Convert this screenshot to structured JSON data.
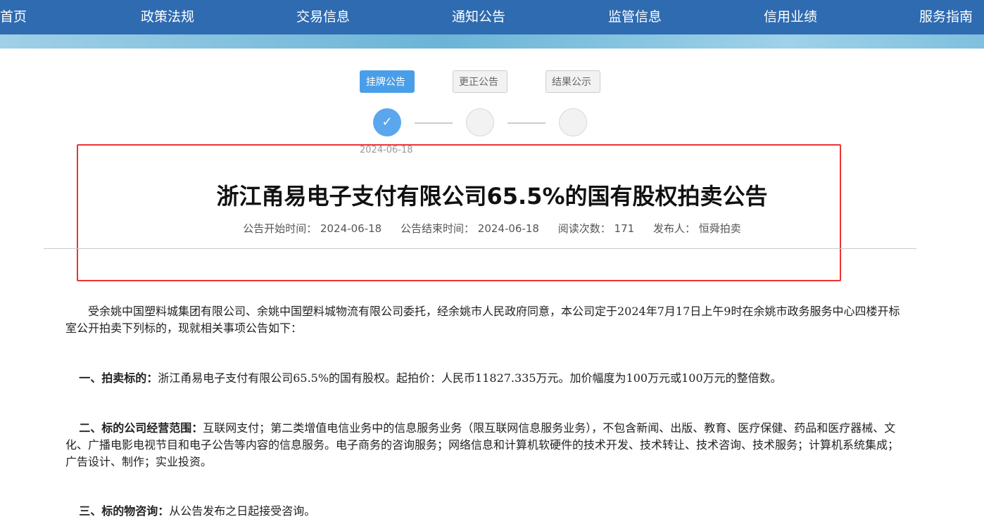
{
  "nav": {
    "items": [
      "首页",
      "政策法规",
      "交易信息",
      "通知公告",
      "监管信息",
      "信用业绩",
      "服务指南"
    ]
  },
  "steps": {
    "buttons": [
      "挂牌公告",
      "更正公告",
      "结果公示"
    ],
    "active_index": 0,
    "check_glyph": "✓",
    "date": "2024-06-18"
  },
  "announcement": {
    "title": "浙江甬易电子支付有限公司65.5%的国有股权拍卖公告",
    "meta": {
      "start_label": "公告开始时间：",
      "start_value": "2024-06-18",
      "end_label": "公告结束时间：",
      "end_value": "2024-06-18",
      "views_label": "阅读次数：",
      "views_value": "171",
      "publisher_label": "发布人：",
      "publisher_value": "恒舜拍卖"
    }
  },
  "body": {
    "intro": "受余姚中国塑料城集团有限公司、余姚中国塑料城物流有限公司委托，经余姚市人民政府同意，本公司定于2024年7月17日上午9时在余姚市政务服务中心四楼开标室公开拍卖下列标的，现就相关事项公告如下：",
    "sec1_label": "一、拍卖标的：",
    "sec1_text": "浙江甬易电子支付有限公司65.5%的国有股权。起拍价：人民币11827.335万元。加价幅度为100万元或100万元的整倍数。",
    "sec2_label": "二、标的公司经营范围：",
    "sec2_text": "互联网支付；第二类增值电信业务中的信息服务业务（限互联网信息服务业务），不包含新闻、出版、教育、医疗保健、药品和医疗器械、文化、广播电影电视节目和电子公告等内容的信息服务。电子商务的咨询服务；网络信息和计算机软硬件的技术开发、技术转让、技术咨询、技术服务；计算机系统集成；广告设计、制作；实业投资。",
    "sec3_label": "三、标的物咨询：",
    "sec3_text": "从公告发布之日起接受咨询。"
  },
  "colors": {
    "nav_bg": "#2f6bb0",
    "step_active": "#4a9ee8",
    "highlight_border": "#e33333"
  }
}
